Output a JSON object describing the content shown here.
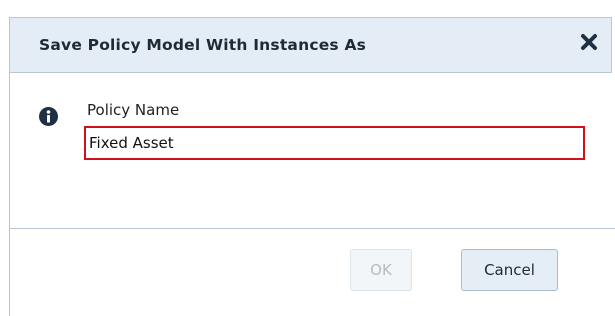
{
  "dialog": {
    "title": "Save Policy Model With Instances As",
    "close_icon": "close-icon",
    "info_icon": "info-icon",
    "field_label": "Policy Name",
    "field_value": "Fixed Asset",
    "ok_label": "OK",
    "ok_enabled": false,
    "cancel_label": "Cancel"
  },
  "colors": {
    "header_bg": "#e4edf5",
    "border": "#b9c6d3",
    "input_highlight": "#d0111b",
    "icon": "#1f3044"
  }
}
